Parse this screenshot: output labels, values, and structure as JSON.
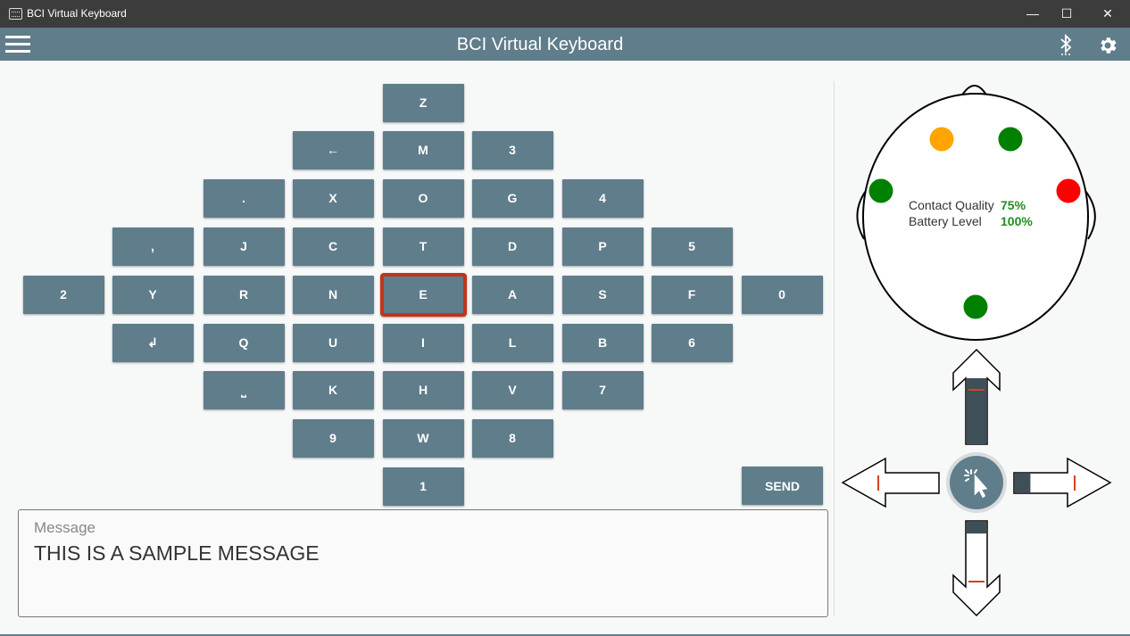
{
  "window": {
    "title": "BCI Virtual Keyboard",
    "controls": [
      "—",
      "☐",
      "✕"
    ]
  },
  "appbar": {
    "title": "BCI Virtual Keyboard"
  },
  "keyboard": {
    "keys": [
      {
        "label": "Z"
      },
      {
        "label": "←"
      },
      {
        "label": "M"
      },
      {
        "label": "3"
      },
      {
        "label": "."
      },
      {
        "label": "X"
      },
      {
        "label": "O"
      },
      {
        "label": "G"
      },
      {
        "label": "4"
      },
      {
        "label": ","
      },
      {
        "label": "J"
      },
      {
        "label": "C"
      },
      {
        "label": "T"
      },
      {
        "label": "D"
      },
      {
        "label": "P"
      },
      {
        "label": "5"
      },
      {
        "label": "2"
      },
      {
        "label": "Y"
      },
      {
        "label": "R"
      },
      {
        "label": "N"
      },
      {
        "label": "E",
        "selected": true
      },
      {
        "label": "A"
      },
      {
        "label": "S"
      },
      {
        "label": "F"
      },
      {
        "label": "0"
      },
      {
        "label": "↲"
      },
      {
        "label": "Q"
      },
      {
        "label": "U"
      },
      {
        "label": "I"
      },
      {
        "label": "L"
      },
      {
        "label": "B"
      },
      {
        "label": "6"
      },
      {
        "label": "⎵"
      },
      {
        "label": "K"
      },
      {
        "label": "H"
      },
      {
        "label": "V"
      },
      {
        "label": "7"
      },
      {
        "label": "9"
      },
      {
        "label": "W"
      },
      {
        "label": "8"
      },
      {
        "label": "1"
      }
    ],
    "send_label": "SEND",
    "selected_color": "#c0351a",
    "key_color": "#607d8b"
  },
  "message": {
    "label": "Message",
    "value": "THIS IS A SAMPLE MESSAGE"
  },
  "headset": {
    "contact_quality_label": "Contact Quality",
    "contact_quality_value": "75%",
    "battery_label": "Battery Level",
    "battery_value": "100%",
    "electrodes": [
      {
        "name": "front-left",
        "color": "#ffa500"
      },
      {
        "name": "front-right",
        "color": "#008000"
      },
      {
        "name": "left",
        "color": "#008000"
      },
      {
        "name": "right",
        "color": "#ff0000"
      },
      {
        "name": "back",
        "color": "#008000"
      }
    ]
  },
  "directions": {
    "up_fill": 1.0,
    "left_fill": 0.0,
    "right_fill": 0.3,
    "down_fill": 0.18
  },
  "icons": {
    "menu": "hamburger-icon",
    "bluetooth": "bluetooth-icon",
    "settings": "gear-icon",
    "center": "click-cursor-icon"
  }
}
